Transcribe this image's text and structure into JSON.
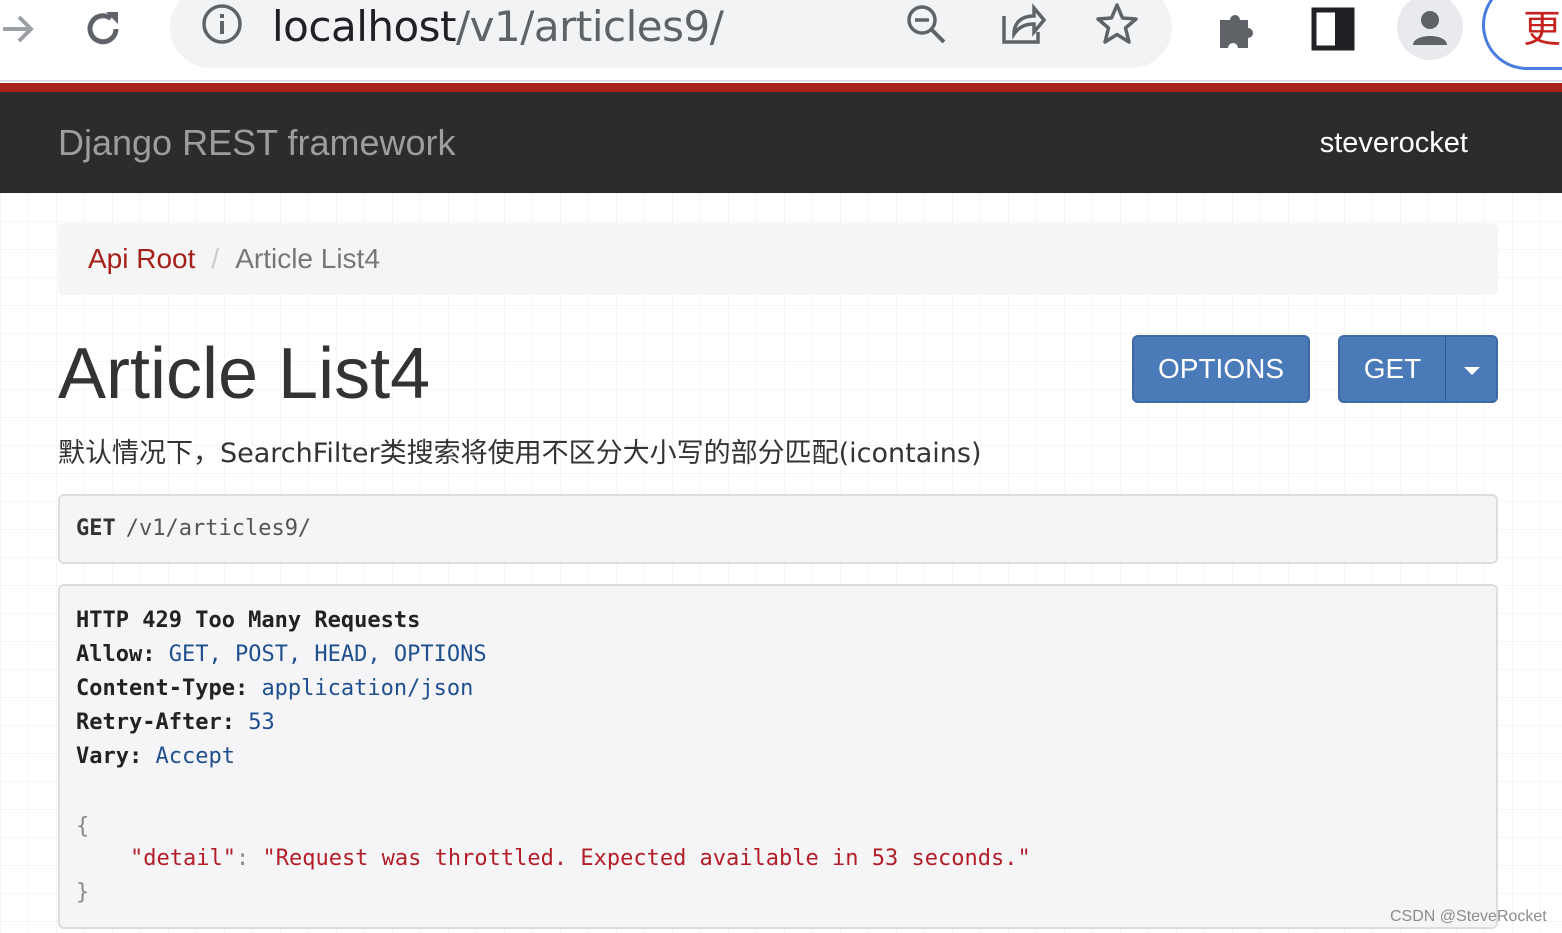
{
  "browser": {
    "url_host": "localhost",
    "url_path": "/v1/articles9/",
    "update_button_label": "更新"
  },
  "navbar": {
    "brand": "Django REST framework",
    "user": "steverocket"
  },
  "breadcrumb": {
    "root_label": "Api Root",
    "separator": "/",
    "current_label": "Article List4"
  },
  "page": {
    "title": "Article List4",
    "description": "默认情况下，SearchFilter类搜索将使用不区分大小写的部分匹配(icontains)"
  },
  "buttons": {
    "options_label": "OPTIONS",
    "get_label": "GET"
  },
  "request": {
    "method": "GET",
    "path": "/v1/articles9/"
  },
  "response": {
    "status_line": "HTTP 429 Too Many Requests",
    "headers": [
      {
        "key": "Allow:",
        "value": "GET, POST, HEAD, OPTIONS"
      },
      {
        "key": "Content-Type:",
        "value": "application/json"
      },
      {
        "key": "Retry-After:",
        "value": "53"
      },
      {
        "key": "Vary:",
        "value": "Accept"
      }
    ],
    "body_open": "{",
    "body_key": "\"detail\"",
    "body_colon": ": ",
    "body_value": "\"Request was throttled. Expected available in 53 seconds.\"",
    "body_close": "}"
  },
  "watermark": "CSDN @SteveRocket",
  "colors": {
    "drf_red": "#a52019",
    "navbar_bg": "#2c2c2c",
    "button_blue": "#4a7ab8",
    "header_value_blue": "#1f4f8f",
    "json_string_red": "#b31d28"
  },
  "icons": [
    "back-arrow-icon",
    "reload-icon",
    "info-icon",
    "zoom-out-icon",
    "share-icon",
    "star-icon",
    "extensions-icon",
    "side-panel-icon",
    "profile-icon",
    "caret-down-icon"
  ]
}
